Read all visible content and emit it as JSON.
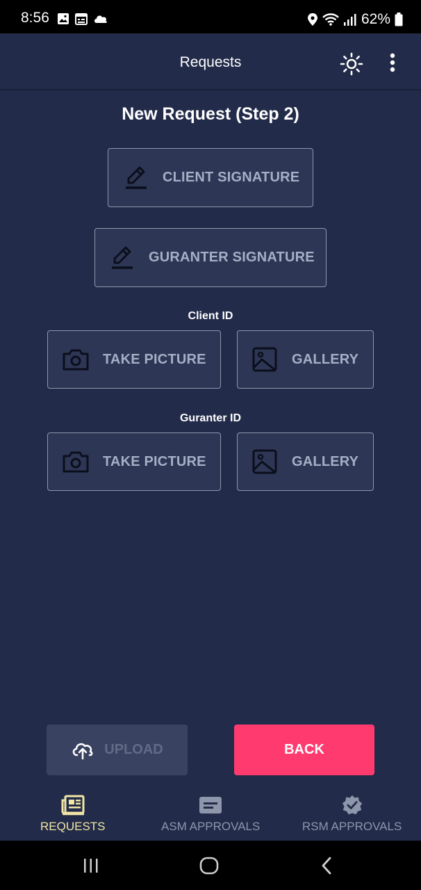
{
  "status_bar": {
    "time": "8:56",
    "battery": "62%",
    "left_icons": [
      "image-icon",
      "calendar-icon",
      "cloud-icon"
    ],
    "right_icons": [
      "location-icon",
      "wifi-icon",
      "signal-icon",
      "battery-icon"
    ]
  },
  "app_bar": {
    "title": "Requests",
    "actions": [
      "brightness-icon",
      "more-vert-icon"
    ]
  },
  "page": {
    "title": "New Request (Step 2)"
  },
  "signatures": {
    "client_label": "CLIENT SIGNATURE",
    "guranter_label": "GURANTER SIGNATURE"
  },
  "client_id": {
    "heading": "Client ID",
    "take_picture_label": "TAKE PICTURE",
    "gallery_label": "GALLERY"
  },
  "guranter_id": {
    "heading": "Guranter ID",
    "take_picture_label": "TAKE PICTURE",
    "gallery_label": "GALLERY"
  },
  "actions": {
    "upload_label": "UPLOAD",
    "back_label": "BACK"
  },
  "bottom_nav": {
    "items": [
      {
        "label": "REQUESTS",
        "icon": "newspaper-icon",
        "active": true
      },
      {
        "label": "ASM APPROVALS",
        "icon": "message-icon",
        "active": false
      },
      {
        "label": "RSM APPROVALS",
        "icon": "verified-badge-icon",
        "active": false
      }
    ]
  },
  "colors": {
    "background": "#222b49",
    "button_fill": "#2d3654",
    "button_border": "#8f97ad",
    "button_text": "#a6afc6",
    "back_button": "#fe3a6e",
    "upload_disabled": "#394260",
    "nav_active": "#f2e6a6",
    "nav_inactive": "#8e96ac"
  }
}
